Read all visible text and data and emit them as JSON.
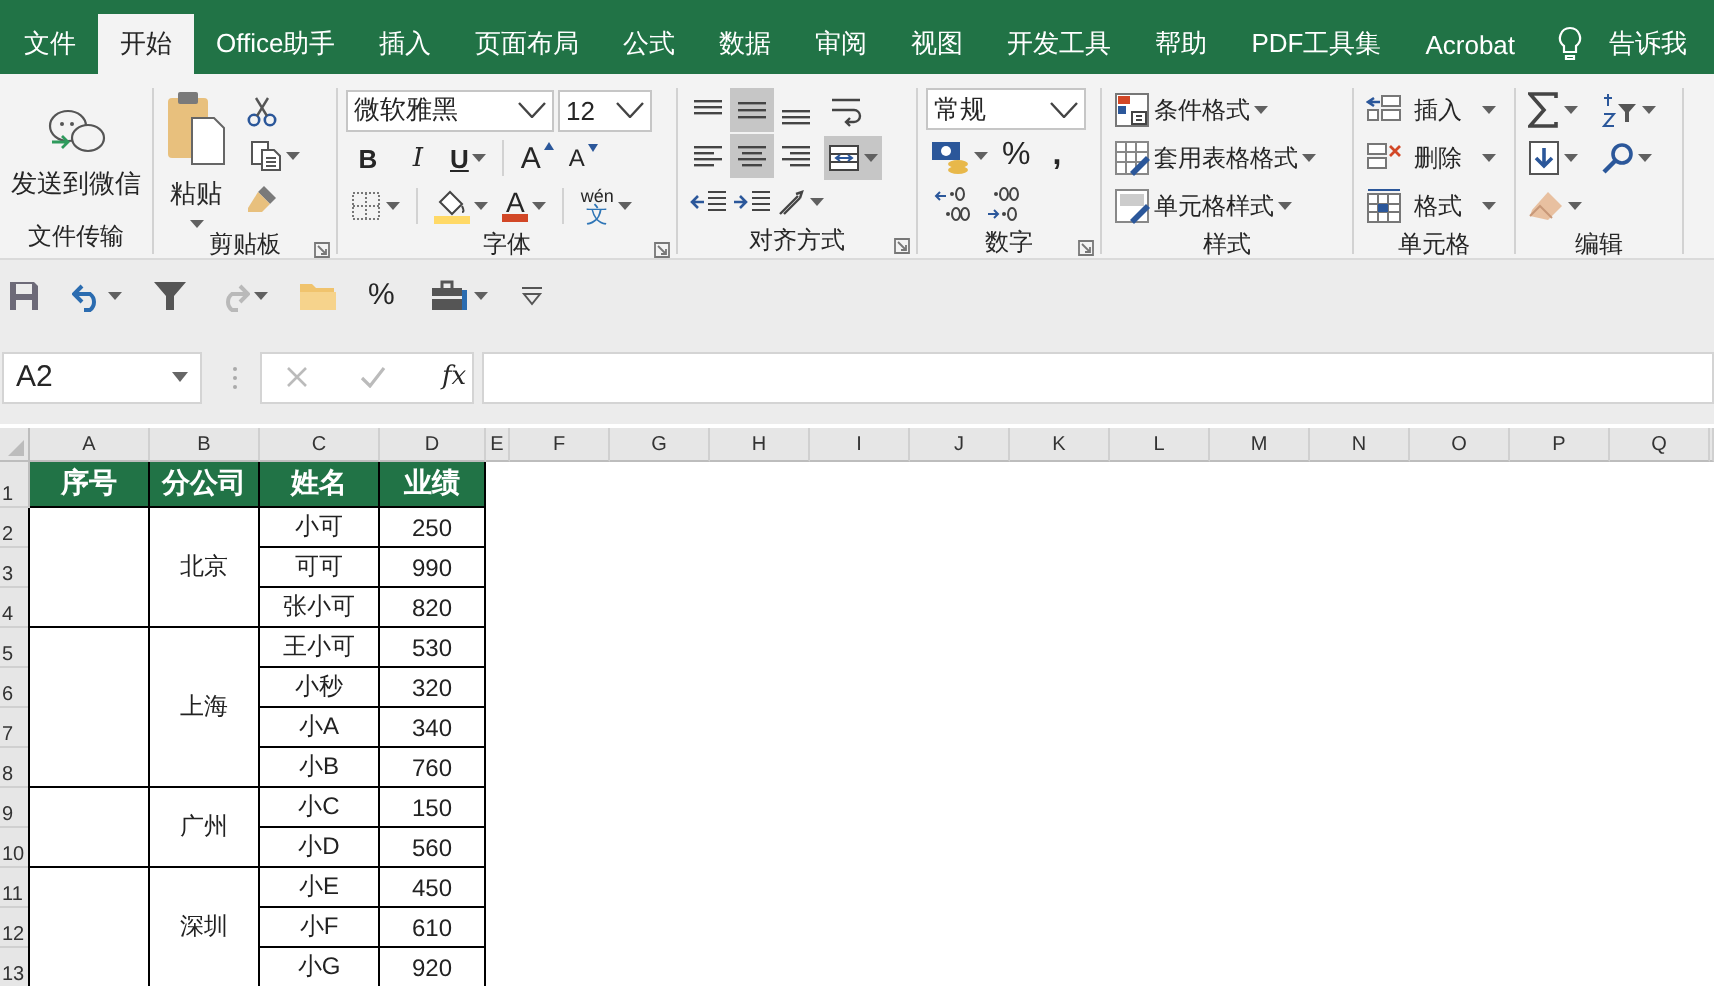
{
  "tabs": [
    {
      "label": "文件",
      "selected": false
    },
    {
      "label": "开始",
      "selected": true
    },
    {
      "label": "Office助手",
      "selected": false
    },
    {
      "label": "插入",
      "selected": false
    },
    {
      "label": "页面布局",
      "selected": false
    },
    {
      "label": "公式",
      "selected": false
    },
    {
      "label": "数据",
      "selected": false
    },
    {
      "label": "审阅",
      "selected": false
    },
    {
      "label": "视图",
      "selected": false
    },
    {
      "label": "开发工具",
      "selected": false
    },
    {
      "label": "帮助",
      "selected": false
    },
    {
      "label": "PDF工具集",
      "selected": false
    },
    {
      "label": "Acrobat",
      "selected": false
    }
  ],
  "tell_me": "告诉我",
  "ribbon": {
    "file_transfer": {
      "button": "发送到微信",
      "group": "文件传输"
    },
    "clipboard": {
      "paste": "粘贴",
      "group": "剪贴板"
    },
    "font": {
      "font_name": "微软雅黑",
      "font_size": "12",
      "bold": "B",
      "italic": "I",
      "underline": "U",
      "grow": "A",
      "shrink": "A",
      "font_color": "A",
      "phonetic_top": "wén",
      "phonetic_bottom": "文",
      "group": "字体"
    },
    "alignment": {
      "buttons": [
        {
          "selected": false
        },
        {
          "selected": true
        },
        {
          "selected": false
        },
        {
          "selected": false
        },
        {
          "selected": true
        },
        {
          "selected": false
        }
      ],
      "merge_selected": true,
      "group": "对齐方式"
    },
    "number": {
      "format": "常规",
      "percent": "%",
      "comma": ",",
      "group": "数字"
    },
    "styles": {
      "items": [
        "条件格式",
        "套用表格格式",
        "单元格样式"
      ],
      "group": "样式"
    },
    "cells": {
      "items": [
        "插入",
        "删除",
        "格式"
      ],
      "group": "单元格"
    },
    "editing": {
      "group": "编辑"
    }
  },
  "quick_access": {
    "percent": "%"
  },
  "name_box": "A2",
  "function_label": "fx",
  "columns": [
    "A",
    "B",
    "C",
    "D",
    "E",
    "F",
    "G",
    "H",
    "I",
    "J",
    "K",
    "L",
    "M",
    "N",
    "O",
    "P",
    "Q"
  ],
  "rows": [
    "1",
    "2",
    "3",
    "4",
    "5",
    "6",
    "7",
    "8",
    "9",
    "10",
    "11",
    "12",
    "13"
  ],
  "table": {
    "header": [
      "序号",
      "分公司",
      "姓名",
      "业绩"
    ],
    "groups": [
      {
        "branch": "北京",
        "people": [
          {
            "name": "小可",
            "score": "250"
          },
          {
            "name": "可可",
            "score": "990"
          },
          {
            "name": "张小可",
            "score": "820"
          }
        ]
      },
      {
        "branch": "上海",
        "people": [
          {
            "name": "王小可",
            "score": "530"
          },
          {
            "name": "小秒",
            "score": "320"
          },
          {
            "name": "小A",
            "score": "340"
          },
          {
            "name": "小B",
            "score": "760"
          }
        ]
      },
      {
        "branch": "广州",
        "people": [
          {
            "name": "小C",
            "score": "150"
          },
          {
            "name": "小D",
            "score": "560"
          }
        ]
      },
      {
        "branch": "深圳",
        "people": [
          {
            "name": "小E",
            "score": "450"
          },
          {
            "name": "小F",
            "score": "610"
          },
          {
            "name": "小G",
            "score": "920"
          }
        ]
      }
    ]
  }
}
